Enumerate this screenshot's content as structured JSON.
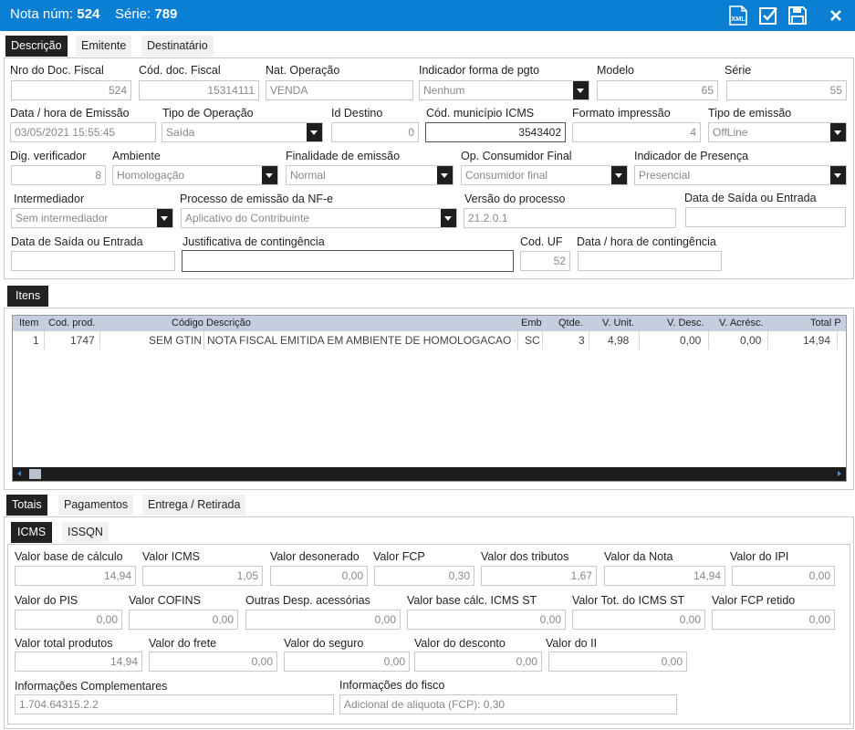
{
  "header": {
    "nota_label": "Nota núm:",
    "nota_num": "524",
    "serie_label": "Série:",
    "serie_num": "789"
  },
  "toolbar": {
    "xml_label": "XML"
  },
  "top_tabs": [
    "Descrição",
    "Emitente",
    "Destinatário"
  ],
  "descricao": {
    "nro_doc_label": "Nro do Doc. Fiscal",
    "nro_doc": "524",
    "cod_doc_label": "Cód. doc. Fiscal",
    "cod_doc": "15314111",
    "nat_op_label": "Nat. Operação",
    "nat_op": "VENDA",
    "ind_pgto_label": "Indicador forma de pgto",
    "ind_pgto": "Nenhum",
    "modelo_label": "Modelo",
    "modelo": "65",
    "serie_label": "Série",
    "serie": "55",
    "data_emissao_label": "Data / hora de Emissão",
    "data_emissao": "03/05/2021 15:55:45",
    "tipo_op_label": "Tipo de Operação",
    "tipo_op": "Saída",
    "id_destino_label": "Id Destino",
    "id_destino": "0",
    "cod_mun_label": "Cód. município ICMS",
    "cod_mun": "3543402",
    "formato_label": "Formato impressão",
    "formato": "4",
    "tipo_emissao_label": "Tipo de emissão",
    "tipo_emissao": "OffLine",
    "dig_label": "Dig. verificador",
    "dig": "8",
    "ambiente_label": "Ambiente",
    "ambiente": "Homologação",
    "finalidade_label": "Finalidade de emissão",
    "finalidade": "Normal",
    "op_consumidor_label": "Op. Consumidor Final",
    "op_consumidor": "Consumidor final",
    "ind_presenca_label": "Indicador de Presença",
    "ind_presenca": "Presencial",
    "intermediador_label": "Intermediador",
    "intermediador": "Sem intermediador",
    "processo_label": "Processo de emissão da NF-e",
    "processo": "Aplicativo do Contribuinte",
    "versao_label": "Versão do processo",
    "versao": "21.2.0.1",
    "data_saida_label": "Data de Saída ou Entrada",
    "data_saida": "",
    "data_saida2_label": "Data de Saída ou Entrada",
    "data_saida2": "",
    "justificativa_label": "Justificativa de contingência",
    "justificativa": "",
    "cod_uf_label": "Cod. UF",
    "cod_uf": "52",
    "data_cont_label": "Data / hora de contingência",
    "data_cont": ""
  },
  "itens_tab": "Itens",
  "itens": {
    "columns": [
      "Item",
      "Cod. prod.",
      "Código",
      "Descrição",
      "Emb",
      "Qtde.",
      "V. Unit.",
      "V. Desc.",
      "V. Acrésc.",
      "Total P"
    ],
    "rows": [
      [
        "1",
        "1747",
        "SEM GTIN",
        "NOTA FISCAL EMITIDA EM AMBIENTE DE HOMOLOGACAO -",
        "SC",
        "3",
        "4,98",
        "0,00",
        "0,00",
        "14,94"
      ]
    ]
  },
  "bottom_tabs": [
    "Totais",
    "Pagamentos",
    "Entrega / Retirada"
  ],
  "tax_tabs": [
    "ICMS",
    "ISSQN"
  ],
  "totais": {
    "vbc_label": "Valor base de cálculo",
    "vbc": "14,94",
    "vicms_label": "Valor ICMS",
    "vicms": "1,05",
    "vdeson_label": "Valor desonerado",
    "vdeson": "0,00",
    "vfcp_label": "Valor FCP",
    "vfcp": "0,30",
    "vtrib_label": "Valor dos tributos",
    "vtrib": "1,67",
    "vnota_label": "Valor da Nota",
    "vnota": "14,94",
    "vipi_label": "Valor do IPI",
    "vipi": "0,00",
    "vpis_label": "Valor do PIS",
    "vpis": "0,00",
    "vcofins_label": "Valor COFINS",
    "vcofins": "0,00",
    "voutras_label": "Outras Desp. acessórias",
    "voutras": "0,00",
    "vbcst_label": "Valor base cálc.  ICMS ST",
    "vbcst": "0,00",
    "vst_label": "Valor Tot. do ICMS ST",
    "vst": "0,00",
    "vfcpret_label": "Valor FCP retido",
    "vfcpret": "0,00",
    "vprod_label": "Valor total produtos",
    "vprod": "14,94",
    "vfrete_label": "Valor do frete",
    "vfrete": "0,00",
    "vseguro_label": "Valor do seguro",
    "vseguro": "0,00",
    "vdesc_label": "Valor do desconto",
    "vdesc": "0,00",
    "vii_label": "Valor do II",
    "vii": "0,00",
    "infcomp_label": "Informações Complementares",
    "infcomp": "1.704.64315.2.2",
    "inffisco_label": "Informações do fisco",
    "inffisco": "Adicional de aliquota (FCP): 0,30"
  }
}
